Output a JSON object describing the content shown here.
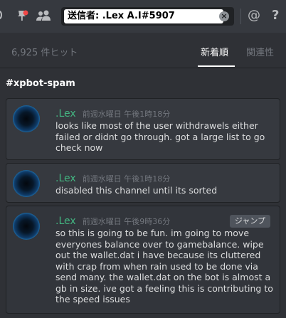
{
  "toolbar": {
    "search_query": "送信者: .Lex A.I#5907",
    "clear_symbol": "×",
    "mention_symbol": "@",
    "help_symbol": "?"
  },
  "results": {
    "count_text": "6,925 件ヒット",
    "sort_newest": "新着順",
    "sort_relevance": "関連性"
  },
  "channel": {
    "name": "#xpbot-spam"
  },
  "messages": [
    {
      "author": ".Lex",
      "timestamp": "前週水曜日 午後1時18分",
      "text": "looks like most of the user withdrawels either failed or didnt go through. got a large list to go check now"
    },
    {
      "author": ".Lex",
      "timestamp": "前週水曜日 午後1時18分",
      "text": "disabled this channel until its sorted"
    },
    {
      "author": ".Lex",
      "timestamp": "前週水曜日 午後9時36分",
      "jump_label": "ジャンプ",
      "text": "so this is going to be fun. im going to move everyones balance over to gamebalance. wipe out the wallet.dat i have because its cluttered with crap from when rain used to be done via send many. the wallet.dat on the bot is almost a gb in size. ive got a feeling this is contributing to the speed issues"
    }
  ],
  "colors": {
    "background": "#2f3136",
    "author": "#43b581",
    "notification_dot": "#f04747"
  }
}
